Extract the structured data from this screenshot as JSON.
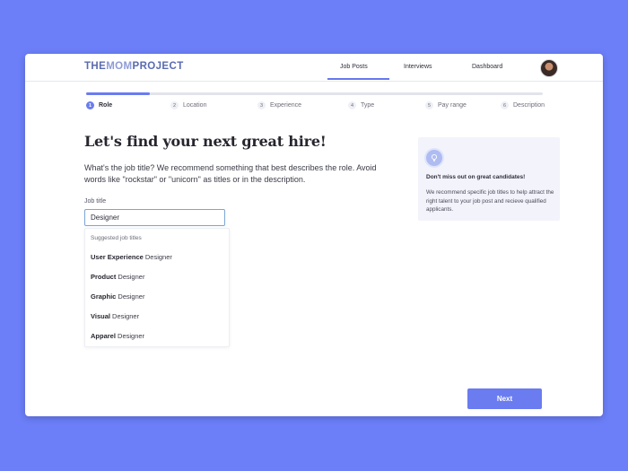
{
  "brand": {
    "logo_part1": "THE",
    "logo_part2": "MOM",
    "logo_part3": "PROJECT"
  },
  "nav": {
    "items": [
      {
        "label": "Job Posts",
        "active": true
      },
      {
        "label": "Interviews",
        "active": false
      },
      {
        "label": "Dashboard",
        "active": false
      }
    ]
  },
  "progress": {
    "fraction_complete": 0.14
  },
  "steps": [
    {
      "number": "1",
      "label": "Role",
      "active": true
    },
    {
      "number": "2",
      "label": "Location",
      "active": false
    },
    {
      "number": "3",
      "label": "Experience",
      "active": false
    },
    {
      "number": "4",
      "label": "Type",
      "active": false
    },
    {
      "number": "5",
      "label": "Pay range",
      "active": false
    },
    {
      "number": "6",
      "label": "Description",
      "active": false
    }
  ],
  "main": {
    "headline": "Let's find your next great hire!",
    "description": "What's the job title? We recommend something that best describes the role. Avoid words like \"rockstar\" or \"unicorn\" as titles or in the description.",
    "job_title_label": "Job title",
    "job_title_value": "Designer"
  },
  "suggestions": {
    "title": "Suggested job titles",
    "items": [
      {
        "bold": "User Experience",
        "rest": " Designer"
      },
      {
        "bold": "Product",
        "rest": " Designer"
      },
      {
        "bold": "Graphic",
        "rest": " Designer"
      },
      {
        "bold": "Visual",
        "rest": " Designer"
      },
      {
        "bold": "Apparel",
        "rest": " Designer"
      }
    ]
  },
  "tip": {
    "icon": "lightbulb-icon",
    "title": "Don't miss out on great candidates!",
    "body": "We recommend specific job titles to help attract the right talent to your job post and recieve qualified applicants."
  },
  "footer": {
    "next_label": "Next"
  },
  "colors": {
    "accent": "#6a7cf0",
    "background": "#6c7ff8"
  }
}
